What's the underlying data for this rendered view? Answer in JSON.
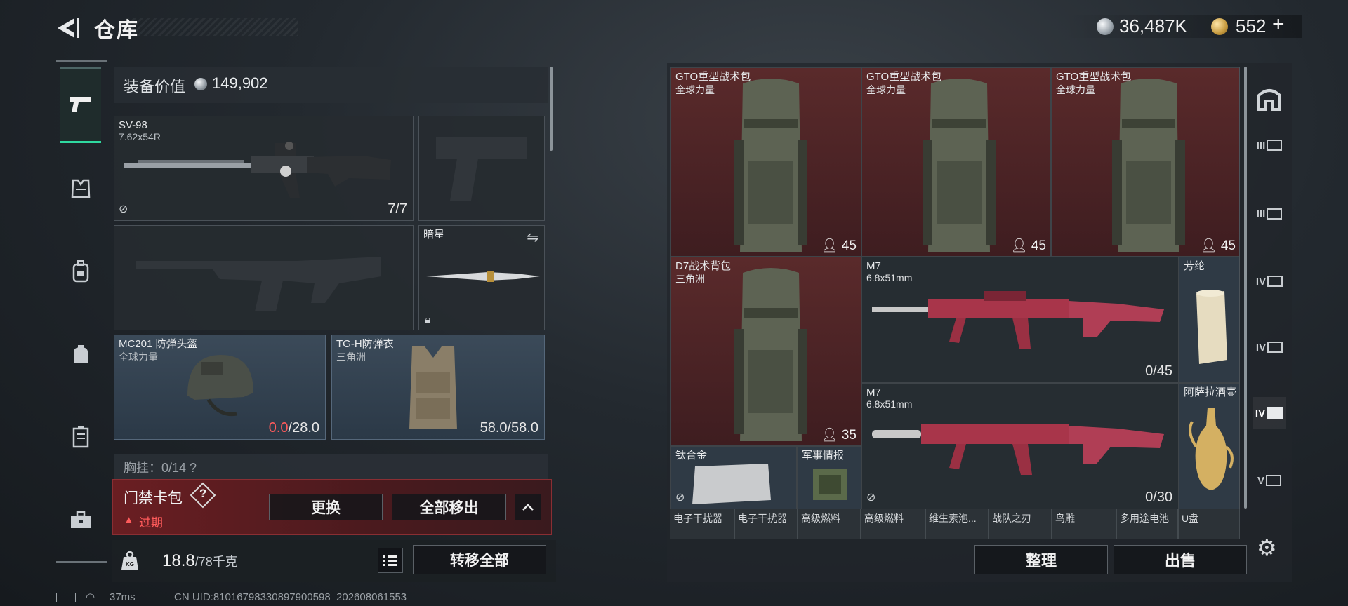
{
  "header": {
    "title": "仓库",
    "currency_silver": "36,487K",
    "currency_gold": "552",
    "plus_label": "+"
  },
  "sidebar": {
    "items": [
      {
        "icon": "pistol-icon",
        "active": true
      },
      {
        "icon": "vest-icon",
        "active": false
      },
      {
        "icon": "backpack-icon",
        "active": false
      },
      {
        "icon": "bag-icon",
        "active": false
      },
      {
        "icon": "locker-icon",
        "active": false
      },
      {
        "icon": "briefcase-icon",
        "active": false
      }
    ]
  },
  "loadout": {
    "value_label": "装备价值",
    "value": "149,902",
    "primary": {
      "name": "SV-98",
      "caliber": "7.62x54R",
      "ammo": "7/7"
    },
    "melee": {
      "name": "暗星"
    },
    "helmet": {
      "name": "MC201 防弹头盔",
      "source": "全球力量",
      "durability_current": "0.0",
      "durability_max": "/28.0"
    },
    "armor": {
      "name": "TG-H防弹衣",
      "source": "三角洲",
      "durability": "58.0/58.0"
    },
    "chest_rig": "胸挂：0/14  ?"
  },
  "keycard": {
    "title": "门禁卡包",
    "help": "?",
    "expired": "过期",
    "replace_button": "更换",
    "remove_all_button": "全部移出",
    "collapse_icon": "chevron-up-icon"
  },
  "weight": {
    "current": "18.8",
    "max": "/78千克",
    "transfer_all_button": "转移全部"
  },
  "status_bar": {
    "ping": "37ms",
    "uid": "CN UID:81016798330897900598_202608061553"
  },
  "stash": {
    "items": [
      {
        "name": "GTO重型战术包",
        "source": "全球力量",
        "count": "45"
      },
      {
        "name": "GTO重型战术包",
        "source": "全球力量",
        "count": "45"
      },
      {
        "name": "GTO重型战术包",
        "source": "全球力量",
        "count": "45"
      },
      {
        "name": "D7战术背包",
        "source": "三角洲",
        "count": "35"
      },
      {
        "name": "M7",
        "caliber": "6.8x51mm",
        "ammo": "0/45"
      },
      {
        "name": "芳纶"
      },
      {
        "name": "M7",
        "caliber": "6.8x51mm",
        "ammo": "0/30"
      },
      {
        "name": "阿萨拉酒壶"
      },
      {
        "name": "钛合金"
      },
      {
        "name": "军事情报"
      }
    ],
    "bottom_row": [
      "电子干扰器",
      "电子干扰器",
      "高级燃料",
      "高级燃料",
      "维生素泡...",
      "战队之刃",
      "鸟雕",
      "多用途电池",
      "U盘"
    ],
    "sort_button": "整理",
    "sell_button": "出售"
  },
  "right_sidebar": {
    "tiers": [
      "",
      "III",
      "III",
      "IV",
      "IV",
      "IV",
      "V"
    ]
  },
  "colors": {
    "accent_teal": "#2fd9a0",
    "red_slot": "#5a2a2b",
    "blue_slot": "#3b4a59",
    "danger": "#ff5b5b"
  }
}
